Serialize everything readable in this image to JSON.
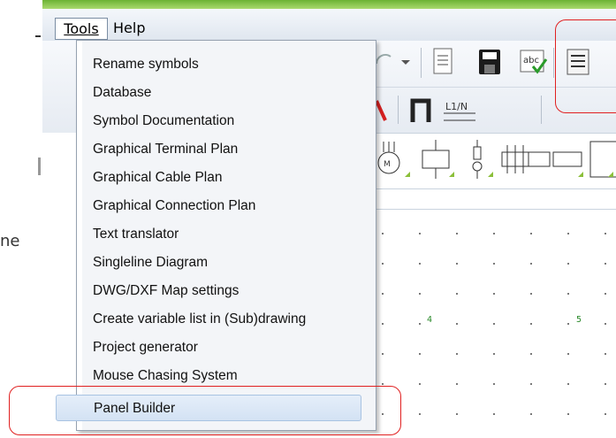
{
  "menubar": {
    "tools": "Tools",
    "help": "Help"
  },
  "tools_menu": {
    "items": [
      "Rename symbols",
      "Database",
      "Symbol Documentation",
      "Graphical Terminal Plan",
      "Graphical Cable Plan",
      "Graphical Connection Plan",
      "Text translator",
      "Singleline Diagram",
      "DWG/DXF Map settings",
      "Create variable list in (Sub)drawing",
      "Project generator",
      "Mouse Chasing System",
      "Panel Builder"
    ],
    "highlighted": "Panel Builder"
  },
  "canvas": {
    "column_numbers": [
      "4",
      "5"
    ]
  },
  "background_text": "ne",
  "toolbar": {
    "l1n_label": "L1/N",
    "abc_label": "abc"
  },
  "colors": {
    "highlight": "#e02020",
    "menu_bg": "#f3f5f8",
    "accent_green": "#6cb234"
  }
}
